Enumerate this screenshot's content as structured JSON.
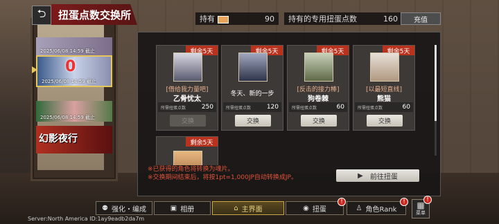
{
  "header": {
    "back_icon": "back-arrow-icon",
    "title": "扭蛋点数交换所",
    "held_label": "持有",
    "held_value": "90",
    "exclusive_label": "持有的专用扭蛋点数",
    "exclusive_value": "160",
    "recharge_label": "充值"
  },
  "banners": [
    {
      "date": "2025/06/08 14:59 截止"
    },
    {
      "date": "2025/06/08 14:59 截止",
      "mark": "0"
    },
    {
      "date": "2025/06/08 14:59 截止"
    },
    {
      "logo": "幻影夜行"
    }
  ],
  "cards": [
    {
      "remain": "剩余5天",
      "subtitle": "[借给我力量吧]",
      "name": "乙骨忧太",
      "cost_label": "所需扭蛋点数",
      "cost": "250",
      "button": "交换",
      "enabled": false
    },
    {
      "remain": "剩余5天",
      "subtitle": "冬天、新的一步",
      "name": "",
      "cost_label": "所需扭蛋点数",
      "cost": "120",
      "button": "交换",
      "enabled": true
    },
    {
      "remain": "剩余5天",
      "subtitle": "[反击的接力棒]",
      "name": "狗卷棘",
      "cost_label": "所需扭蛋点数",
      "cost": "60",
      "button": "交换",
      "enabled": true
    },
    {
      "remain": "剩余5天",
      "subtitle": "[以最短直线]",
      "name": "熊猫",
      "cost_label": "所需扭蛋点数",
      "cost": "60",
      "button": "交换",
      "enabled": true
    },
    {
      "remain": "剩余5天"
    }
  ],
  "notes": {
    "line1": "※已获得的角色将转换为魂片。",
    "line2": "※交换期间结束后，将按1pt=1,000JP自动转换成JP。"
  },
  "go_button": "前往扭蛋",
  "nav": {
    "strengthen": "强化・编成",
    "album": "相册",
    "main": "主界面",
    "gacha": "扭蛋",
    "rank": "角色Rank",
    "menu": "菜单",
    "alert": "!"
  },
  "server_info": "Server:North America ID:1ay9eadb2da7m"
}
